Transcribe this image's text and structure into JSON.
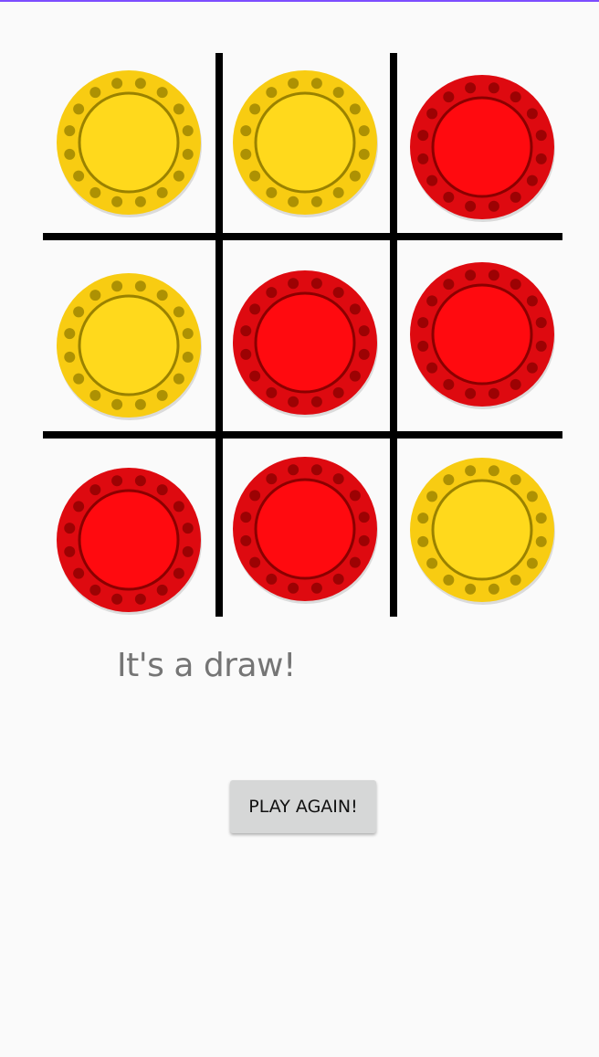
{
  "game": {
    "status_text": "It's a draw!",
    "play_again_label": "PLAY AGAIN!",
    "board": [
      [
        "yellow",
        "yellow",
        "red"
      ],
      [
        "yellow",
        "red",
        "red"
      ],
      [
        "red",
        "red",
        "yellow"
      ]
    ]
  },
  "colors": {
    "background": "#fafafa",
    "grid_line": "#000000",
    "yellow_fill": "#ffd91c",
    "yellow_outer": "#f8cc12",
    "yellow_accent": "#9a8200",
    "red_fill": "#ff0a0f",
    "red_outer": "#de0a10",
    "red_accent": "#8b0000",
    "button_bg": "#d6d7d7",
    "status_text": "#757575"
  }
}
